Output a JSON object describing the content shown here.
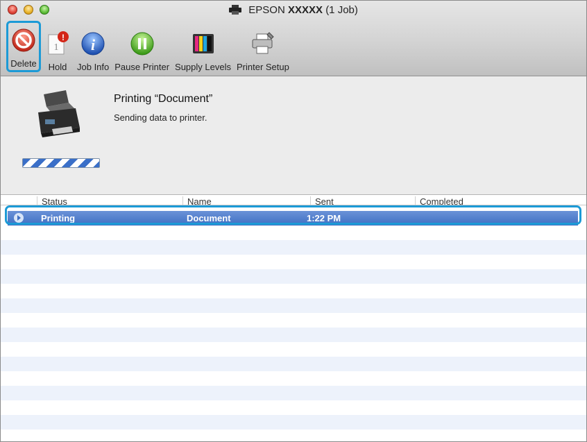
{
  "window": {
    "title_prefix": "EPSON",
    "title_model": "XXXXX",
    "title_suffix": "(1 Job)"
  },
  "toolbar": {
    "delete_label": "Delete",
    "hold_label": "Hold",
    "job_info_label": "Job Info",
    "pause_printer_label": "Pause Printer",
    "supply_levels_label": "Supply Levels",
    "printer_setup_label": "Printer Setup",
    "hold_badge": "!",
    "hold_page_number": "1"
  },
  "status": {
    "title": "Printing “Document”",
    "message": "Sending data to printer.",
    "progress": 1.0
  },
  "table": {
    "columns": [
      "Status",
      "Name",
      "Sent",
      "Completed"
    ],
    "rows": [
      {
        "status": "Printing",
        "name": "Document",
        "sent": "1:22 PM",
        "completed": ""
      }
    ]
  },
  "colors": {
    "highlight": "#1c9ad6",
    "selection": "#3f6fc2",
    "row_alt": "#edf2fb"
  }
}
